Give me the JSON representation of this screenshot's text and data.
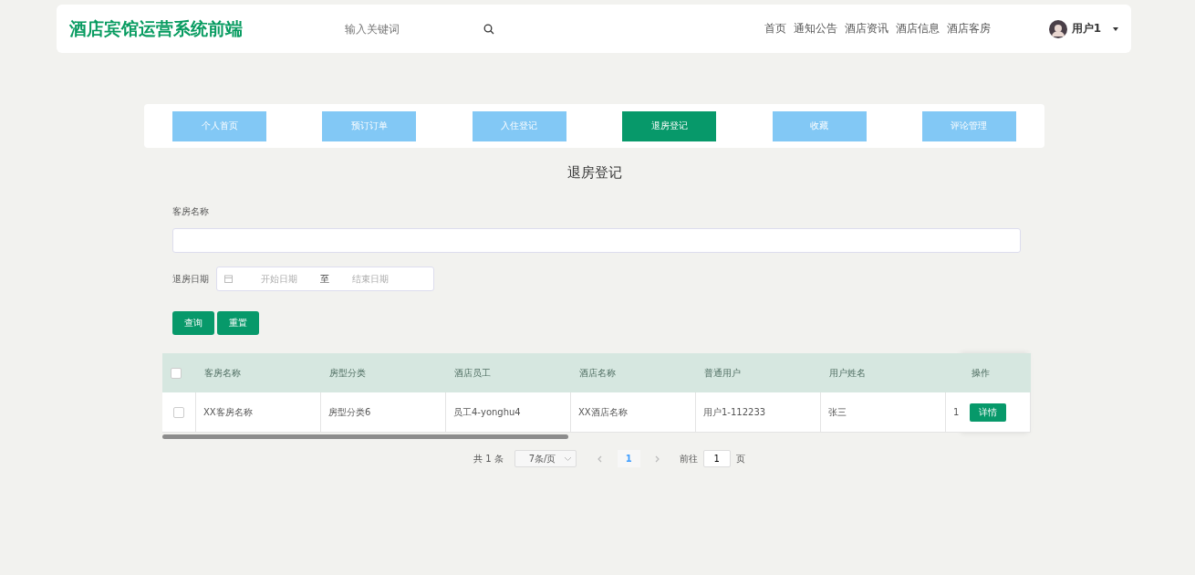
{
  "header": {
    "logo": "酒店宾馆运营系统前端",
    "search": {
      "placeholder": "输入关键词"
    },
    "nav": [
      "首页",
      "通知公告",
      "酒店资讯",
      "酒店信息",
      "酒店客房"
    ],
    "user": "用户1"
  },
  "tabs": [
    {
      "label": "个人首页",
      "selected": false
    },
    {
      "label": "预订订单",
      "selected": false
    },
    {
      "label": "入住登记",
      "selected": false
    },
    {
      "label": "退房登记",
      "selected": true
    },
    {
      "label": "收藏",
      "selected": false
    },
    {
      "label": "评论管理",
      "selected": false
    }
  ],
  "page_title": "退房登记",
  "form": {
    "room_name_label": "客房名称",
    "date_label": "退房日期",
    "start_placeholder": "开始日期",
    "separator": "至",
    "end_placeholder": "结束日期",
    "buttons": [
      "查询",
      "重置"
    ]
  },
  "table": {
    "select_all_checked": false,
    "columns": [
      "客房名称",
      "房型分类",
      "酒店员工",
      "酒店名称",
      "普通用户",
      "用户姓名"
    ],
    "action_column": "操作",
    "rows": [
      {
        "checked": false,
        "cells": [
          "XX客房名称",
          "房型分类6",
          "员工4-yonghu4",
          "XX酒店名称",
          "用户1-112233",
          "张三",
          "1"
        ],
        "action": "详情"
      }
    ]
  },
  "pagination": {
    "total": "共 1 条",
    "page_size": "7条/页",
    "pages": [
      {
        "label": "1",
        "selected": true
      }
    ],
    "goto_label": "前往",
    "goto_value": "1",
    "goto_suffix": "页"
  }
}
